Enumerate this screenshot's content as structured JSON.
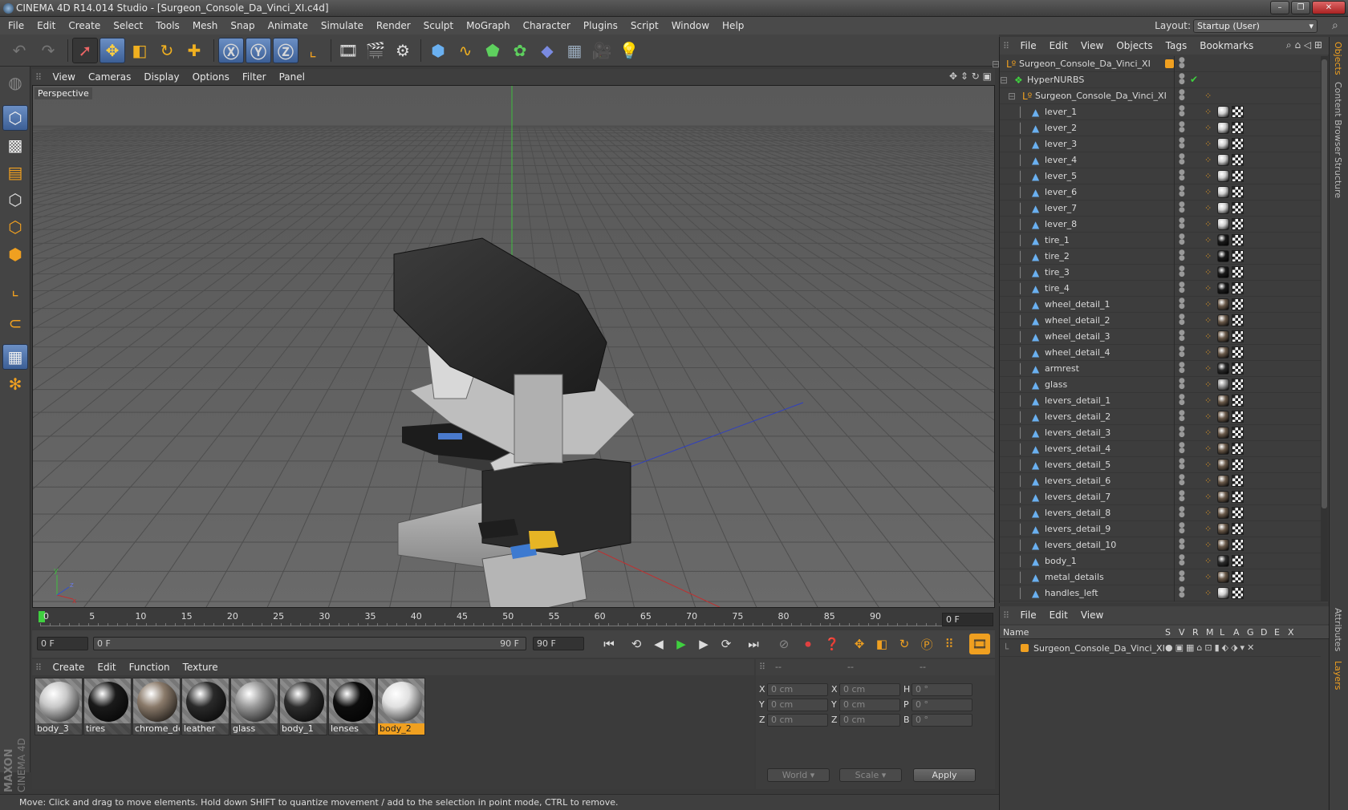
{
  "window": {
    "title": "CINEMA 4D R14.014 Studio - [Surgeon_Console_Da_Vinci_XI.c4d]",
    "controls": [
      "–",
      "❐",
      "✕"
    ]
  },
  "menubar": [
    "File",
    "Edit",
    "Create",
    "Select",
    "Tools",
    "Mesh",
    "Snap",
    "Animate",
    "Simulate",
    "Render",
    "Sculpt",
    "MoGraph",
    "Character",
    "Plugins",
    "Script",
    "Window",
    "Help"
  ],
  "layout": {
    "label": "Layout:",
    "value": "Startup (User)"
  },
  "viewport": {
    "menu": [
      "View",
      "Cameras",
      "Display",
      "Options",
      "Filter",
      "Panel"
    ],
    "label": "Perspective"
  },
  "timeline": {
    "ticks": [
      "0",
      "5",
      "10",
      "15",
      "20",
      "25",
      "30",
      "35",
      "40",
      "45",
      "50",
      "55",
      "60",
      "65",
      "70",
      "75",
      "80",
      "85",
      "90"
    ],
    "current_frame": "0 F"
  },
  "playbar": {
    "start": "0 F",
    "range_start": "0 F",
    "range_end": "90 F",
    "end": "90 F"
  },
  "materials": {
    "menu": [
      "Create",
      "Edit",
      "Function",
      "Texture"
    ],
    "items": [
      {
        "name": "body_3",
        "color": "#c8c8c8"
      },
      {
        "name": "tires",
        "color": "#1a1a1a"
      },
      {
        "name": "chrome_de",
        "color": "#8a7a6a"
      },
      {
        "name": "leather",
        "color": "#2a2a2a"
      },
      {
        "name": "glass",
        "color": "#9a9a9a"
      },
      {
        "name": "body_1",
        "color": "#2c2c2c"
      },
      {
        "name": "lenses",
        "color": "#0d0d0d"
      },
      {
        "name": "body_2",
        "color": "#e0e0e0"
      }
    ],
    "selected": "body_2"
  },
  "coordinates": {
    "header": [
      "--",
      "--",
      "--"
    ],
    "rows": [
      {
        "a": "X",
        "av": "0 cm",
        "b": "X",
        "bv": "0 cm",
        "c": "H",
        "cv": "0 °"
      },
      {
        "a": "Y",
        "av": "0 cm",
        "b": "Y",
        "bv": "0 cm",
        "c": "P",
        "cv": "0 °"
      },
      {
        "a": "Z",
        "av": "0 cm",
        "b": "Z",
        "bv": "0 cm",
        "c": "B",
        "cv": "0 °"
      }
    ],
    "mode": "World",
    "scale": "Scale",
    "apply": "Apply"
  },
  "status": "Move: Click and drag to move elements. Hold down SHIFT to quantize movement / add to the selection in point mode, CTRL to remove.",
  "objects": {
    "menu": [
      "File",
      "Edit",
      "View",
      "Objects",
      "Tags",
      "Bookmarks"
    ],
    "root": "Surgeon_Console_Da_Vinci_XI",
    "nurbs": "HyperNURBS",
    "group": "Surgeon_Console_Da_Vinci_XI",
    "children": [
      {
        "name": "lever_1",
        "mat": "#cfcfcf"
      },
      {
        "name": "lever_2",
        "mat": "#cfcfcf"
      },
      {
        "name": "lever_3",
        "mat": "#cfcfcf"
      },
      {
        "name": "lever_4",
        "mat": "#cfcfcf"
      },
      {
        "name": "lever_5",
        "mat": "#cfcfcf"
      },
      {
        "name": "lever_6",
        "mat": "#cfcfcf"
      },
      {
        "name": "lever_7",
        "mat": "#cfcfcf"
      },
      {
        "name": "lever_8",
        "mat": "#cfcfcf"
      },
      {
        "name": "tire_1",
        "mat": "#1a1a1a"
      },
      {
        "name": "tire_2",
        "mat": "#1a1a1a"
      },
      {
        "name": "tire_3",
        "mat": "#1a1a1a"
      },
      {
        "name": "tire_4",
        "mat": "#1a1a1a"
      },
      {
        "name": "wheel_detail_1",
        "mat": "#6a5a4a"
      },
      {
        "name": "wheel_detail_2",
        "mat": "#6a5a4a"
      },
      {
        "name": "wheel_detail_3",
        "mat": "#6a5a4a"
      },
      {
        "name": "wheel_detail_4",
        "mat": "#6a5a4a"
      },
      {
        "name": "armrest",
        "mat": "#2a2a2a"
      },
      {
        "name": "glass",
        "mat": "#9a9a9a"
      },
      {
        "name": "levers_detail_1",
        "mat": "#6a5a4a"
      },
      {
        "name": "levers_detail_2",
        "mat": "#6a5a4a"
      },
      {
        "name": "levers_detail_3",
        "mat": "#6a5a4a"
      },
      {
        "name": "levers_detail_4",
        "mat": "#6a5a4a"
      },
      {
        "name": "levers_detail_5",
        "mat": "#6a5a4a"
      },
      {
        "name": "levers_detail_6",
        "mat": "#6a5a4a"
      },
      {
        "name": "levers_detail_7",
        "mat": "#6a5a4a"
      },
      {
        "name": "levers_detail_8",
        "mat": "#6a5a4a"
      },
      {
        "name": "levers_detail_9",
        "mat": "#6a5a4a"
      },
      {
        "name": "levers_detail_10",
        "mat": "#6a5a4a"
      },
      {
        "name": "body_1",
        "mat": "#2c2c2c"
      },
      {
        "name": "metal_details",
        "mat": "#6a5a4a"
      },
      {
        "name": "handles_left",
        "mat": "#cfcfcf"
      }
    ]
  },
  "layers": {
    "menu": [
      "File",
      "Edit",
      "View"
    ],
    "columns": [
      "Name",
      "S",
      "V",
      "R",
      "M",
      "L",
      "A",
      "G",
      "D",
      "E",
      "X"
    ],
    "row": "Surgeon_Console_Da_Vinci_XI"
  },
  "sidetabs": [
    "Objects",
    "Content Browser",
    "Structure",
    "Attributes",
    "Layers"
  ],
  "colors": {
    "accent": "#f0a020",
    "selection_blue": "#5a7fb8"
  }
}
